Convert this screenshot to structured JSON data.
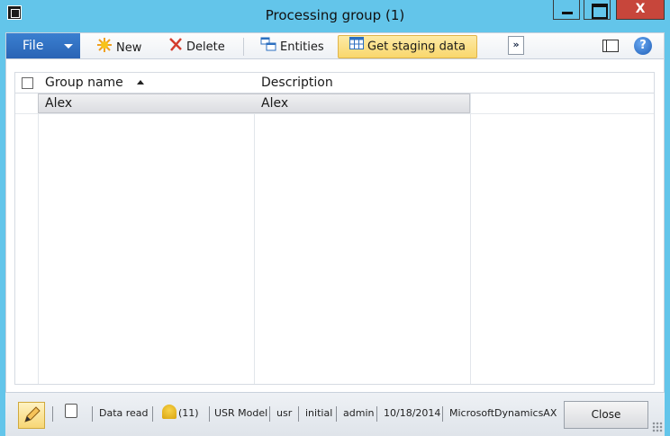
{
  "window": {
    "title": "Processing group (1)",
    "close_glyph": "X"
  },
  "ribbon": {
    "file_label": "File",
    "new_label": "New",
    "delete_label": "Delete",
    "entities_label": "Entities",
    "staging_label": "Get staging data",
    "more_glyph": "»",
    "help_glyph": "?"
  },
  "grid": {
    "columns": [
      "Group name",
      "Description"
    ],
    "sort_column": "Group name",
    "rows": [
      {
        "group_name": "Alex",
        "description": "Alex"
      }
    ]
  },
  "statusbar": {
    "data_status": "Data read",
    "alerts": "(11)",
    "model": "USR Model",
    "layer": "usr",
    "company": "initial",
    "user": "admin",
    "date": "10/18/2014",
    "instance": "MicrosoftDynamicsAX",
    "close_label": "Close"
  },
  "colors": {
    "title_bar": "#63c5ea",
    "file_button": "#2a64b5",
    "staging_highlight": "#f9d76c",
    "close_window": "#c7463b"
  }
}
